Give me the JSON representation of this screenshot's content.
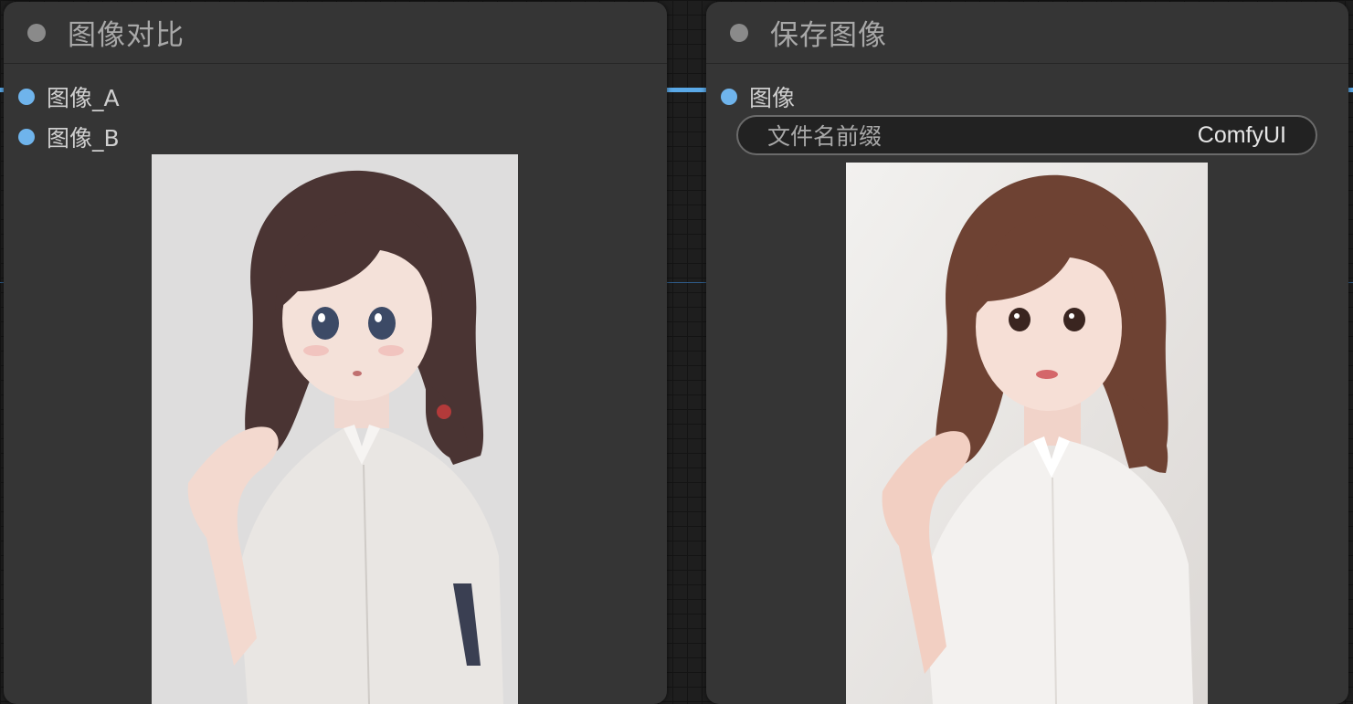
{
  "nodes": {
    "compare": {
      "title": "图像对比",
      "inputs": [
        "图像_A",
        "图像_B"
      ],
      "preview": {
        "style": "anime illustration",
        "bg": "#dedddd"
      }
    },
    "save": {
      "title": "保存图像",
      "inputs": [
        "图像"
      ],
      "widget": {
        "label": "文件名前缀",
        "value": "ComfyUI"
      },
      "preview": {
        "style": "semi-realistic render",
        "bg": "#ecebea"
      }
    }
  },
  "colors": {
    "canvas": "#1e1e1e",
    "node_body": "#353535",
    "link": "#5aa9e8",
    "slot_dot": "#6fb4ec",
    "title_dot": "#8a8a8a"
  }
}
